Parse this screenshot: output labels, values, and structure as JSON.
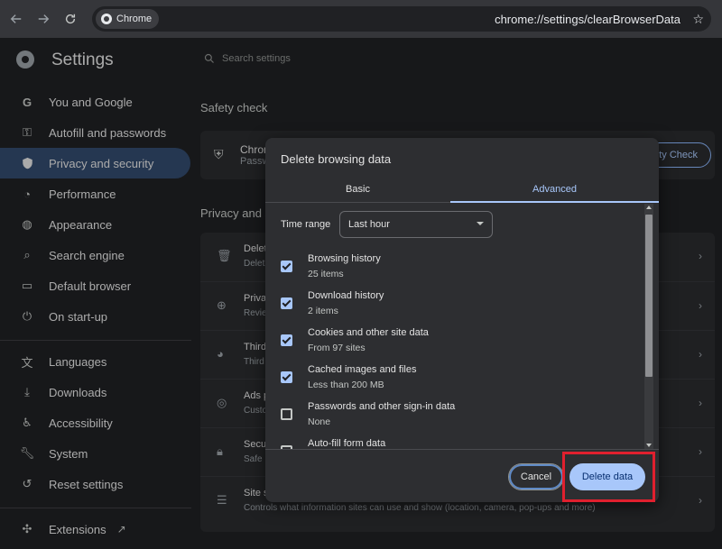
{
  "browser": {
    "chip_label": "Chrome",
    "url": "chrome://settings/clearBrowserData"
  },
  "settings": {
    "title": "Settings",
    "search_placeholder": "Search settings"
  },
  "sidebar": {
    "items": [
      {
        "label": "You and Google",
        "icon": "google-icon"
      },
      {
        "label": "Autofill and passwords",
        "icon": "key-icon"
      },
      {
        "label": "Privacy and security",
        "icon": "shield-icon",
        "active": true
      },
      {
        "label": "Performance",
        "icon": "speedometer-icon"
      },
      {
        "label": "Appearance",
        "icon": "palette-icon"
      },
      {
        "label": "Search engine",
        "icon": "search-icon"
      },
      {
        "label": "Default browser",
        "icon": "browser-icon"
      },
      {
        "label": "On start-up",
        "icon": "power-icon"
      }
    ],
    "items2": [
      {
        "label": "Languages",
        "icon": "translate-icon"
      },
      {
        "label": "Downloads",
        "icon": "download-icon"
      },
      {
        "label": "Accessibility",
        "icon": "accessibility-icon"
      },
      {
        "label": "System",
        "icon": "wrench-icon"
      },
      {
        "label": "Reset settings",
        "icon": "reset-icon"
      }
    ],
    "extensions": "Extensions"
  },
  "main": {
    "safety_title": "Safety check",
    "safety_card_title": "Chrom",
    "safety_card_sub": "Passw",
    "safety_button": "ty Check",
    "privacy_title": "Privacy and s",
    "rows": [
      {
        "t1": "Delet",
        "t2": "Delet"
      },
      {
        "t1": "Priva",
        "t2": "Revie"
      },
      {
        "t1": "Third",
        "t2": "Third"
      },
      {
        "t1": "Ads p",
        "t2": "Custo"
      },
      {
        "t1": "Secu",
        "t2": "Safe"
      },
      {
        "t1": "Site s",
        "t2": "Controls what information sites can use and show (location, camera, pop-ups and more)"
      }
    ]
  },
  "dialog": {
    "title": "Delete browsing data",
    "tabs": [
      "Basic",
      "Advanced"
    ],
    "active_tab": "Advanced",
    "time_range_label": "Time range",
    "time_range_value": "Last hour",
    "items": [
      {
        "label": "Browsing history",
        "sub": "25 items",
        "checked": true
      },
      {
        "label": "Download history",
        "sub": "2 items",
        "checked": true
      },
      {
        "label": "Cookies and other site data",
        "sub": "From 97 sites",
        "checked": true
      },
      {
        "label": "Cached images and files",
        "sub": "Less than 200 MB",
        "checked": true
      },
      {
        "label": "Passwords and other sign-in data",
        "sub": "None",
        "checked": false
      },
      {
        "label": "Auto-fill form data",
        "sub": "",
        "checked": false
      }
    ],
    "cancel": "Cancel",
    "delete": "Delete data"
  },
  "colors": {
    "accent": "#a8c7fa",
    "highlight": "#e0202e",
    "active_nav": "#324a6d"
  }
}
